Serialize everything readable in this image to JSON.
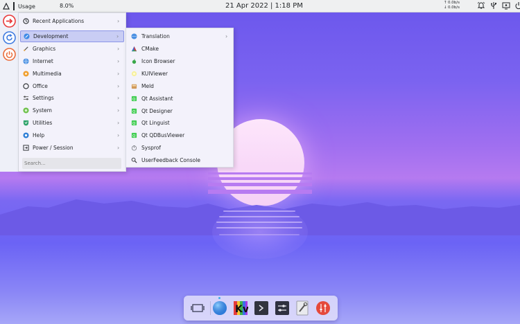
{
  "top_panel": {
    "launcher_icon": "kde-launcher-icon",
    "usage_label": "Usage",
    "usage_value": "8.0%",
    "clock": "21 Apr 2022 | 1:18 PM",
    "net_up": "0.0b/s",
    "net_down": "0.0b/s",
    "tray_icons": [
      "notifications-icon",
      "usb-icon",
      "screen-icon",
      "power-icon"
    ]
  },
  "favorites": [
    {
      "name": "logout-icon",
      "color": "#e93a3a"
    },
    {
      "name": "restart-icon",
      "color": "#3f7be0"
    },
    {
      "name": "shutdown-icon",
      "color": "#ea6c3a"
    }
  ],
  "categories": [
    {
      "label": "Recent Applications",
      "icon": "clock-icon"
    },
    {
      "label": "Development",
      "icon": "development-icon"
    },
    {
      "label": "Graphics",
      "icon": "graphics-icon"
    },
    {
      "label": "Internet",
      "icon": "internet-icon"
    },
    {
      "label": "Multimedia",
      "icon": "multimedia-icon"
    },
    {
      "label": "Office",
      "icon": "office-icon"
    },
    {
      "label": "Settings",
      "icon": "settings-icon"
    },
    {
      "label": "System",
      "icon": "system-icon"
    },
    {
      "label": "Utilities",
      "icon": "utilities-icon"
    },
    {
      "label": "Help",
      "icon": "help-icon"
    },
    {
      "label": "Power / Session",
      "icon": "power-session-icon"
    }
  ],
  "search": {
    "placeholder": "Search..."
  },
  "development_apps": [
    {
      "label": "Translation",
      "icon": "translation-icon"
    },
    {
      "label": "CMake",
      "icon": "cmake-icon"
    },
    {
      "label": "Icon Browser",
      "icon": "icon-browser-icon"
    },
    {
      "label": "KUIViewer",
      "icon": "kuiviewer-icon"
    },
    {
      "label": "Meld",
      "icon": "meld-icon"
    },
    {
      "label": "Qt Assistant",
      "icon": "qt-assistant-icon"
    },
    {
      "label": "Qt Designer",
      "icon": "qt-designer-icon"
    },
    {
      "label": "Qt Linguist",
      "icon": "qt-linguist-icon"
    },
    {
      "label": "Qt QDBusViewer",
      "icon": "qt-qdbusviewer-icon"
    },
    {
      "label": "Sysprof",
      "icon": "sysprof-icon"
    },
    {
      "label": "UserFeedback Console",
      "icon": "userfeedback-console-icon"
    }
  ],
  "dock": [
    "show-desktop-icon",
    "browser-icon",
    "kvantum-icon",
    "terminal-icon",
    "settings-manager-icon",
    "system-tools-icon",
    "mixer-icon"
  ],
  "colors": {
    "accent": "#3daee9",
    "menu_bg": "#f3f2fb",
    "active": "#c9cdf4"
  }
}
